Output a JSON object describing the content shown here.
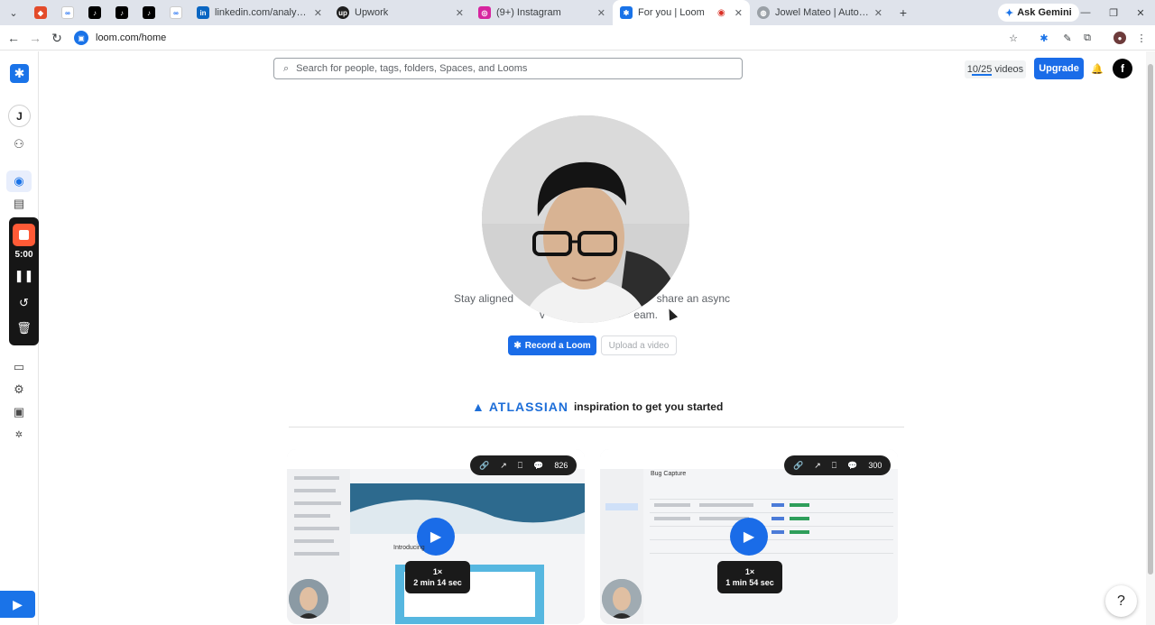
{
  "browser": {
    "tabs": [
      {
        "label": "",
        "active": false
      },
      {
        "label": "",
        "active": false
      },
      {
        "label": "",
        "active": false
      },
      {
        "label": "",
        "active": false
      },
      {
        "label": "",
        "active": false
      },
      {
        "label": "",
        "active": false
      },
      {
        "label": "linkedin.com/analytics/profile-v",
        "active": false
      },
      {
        "label": "Upwork",
        "active": false
      },
      {
        "label": "(9+) Instagram",
        "active": false
      },
      {
        "label": "For you | Loom",
        "active": true
      },
      {
        "label": "Jowel Mateo | Automation Engi",
        "active": false
      }
    ],
    "ask_gemini": "Ask Gemini",
    "url": "loom.com/home"
  },
  "sidebar": {
    "user_initial": "J",
    "recorder_time": "5:00"
  },
  "header": {
    "search_placeholder": "Search for people, tags, folders, Spaces, and Looms",
    "video_count": "10/25 videos",
    "upgrade_label": "Upgrade",
    "avatar_letter": "f"
  },
  "hero": {
    "tagline_left": "Stay aligned",
    "tagline_right": "share an async",
    "tagline_line2_left": "v",
    "tagline_line2_right": "eam.",
    "record_label": "Record a Loom",
    "upload_label": "Upload a video"
  },
  "inspiration": {
    "brand": "ATLASSIAN",
    "text": "inspiration to get you started"
  },
  "cards": [
    {
      "comments": "826",
      "speed": "1×",
      "duration": "2 min 14 sec",
      "caption": "Introducing"
    },
    {
      "comments": "300",
      "speed": "1×",
      "duration": "1 min 54 sec",
      "caption": "Bug Capture"
    }
  ],
  "colors": {
    "accent": "#1a6ce8",
    "recorder_bg": "#161616",
    "record_stop": "#ff5a36"
  }
}
